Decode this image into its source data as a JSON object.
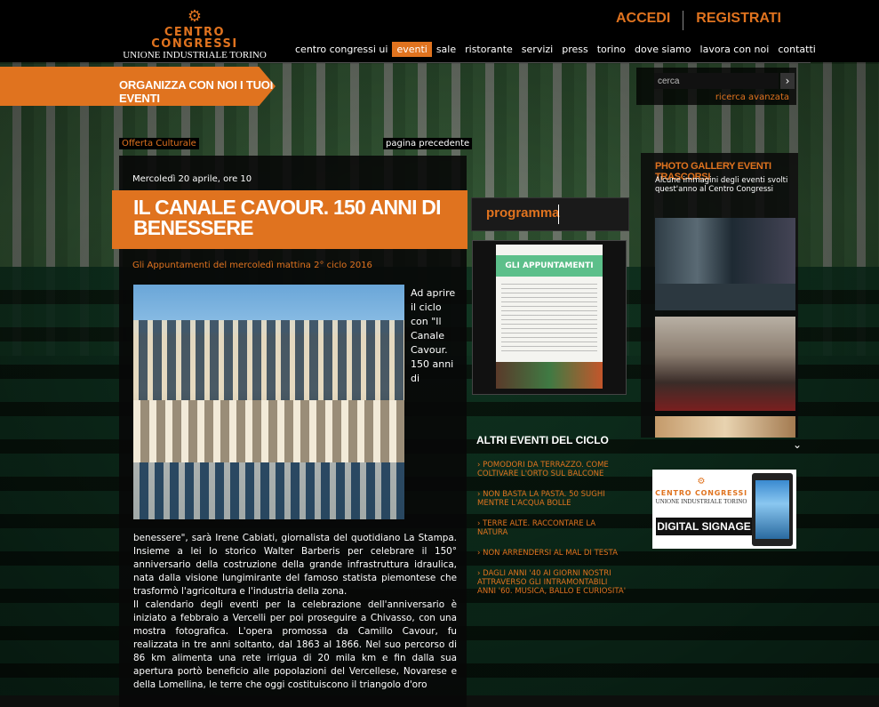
{
  "header": {
    "logo_mark": "⚙",
    "logo_line1": "CENTRO CONGRESSI",
    "logo_line2": "UNIONE INDUSTRIALE TORINO",
    "login": "ACCEDI",
    "register": "REGISTRATI"
  },
  "nav": {
    "items": [
      "centro congressi ui",
      "eventi",
      "sale",
      "ristorante",
      "servizi",
      "press",
      "torino",
      "dove siamo",
      "lavora con noi",
      "contatti"
    ],
    "active": "eventi"
  },
  "banner": {
    "label": "ORGANIZZA CON NOI I TUOI EVENTI"
  },
  "search": {
    "value": "cerca",
    "go_symbol": "›",
    "advanced": "ricerca avanzata"
  },
  "article": {
    "category": "Offerta Culturale",
    "back": "pagina precedente",
    "date": "Mercoledì 20 aprile, ore 10",
    "title": "IL CANALE CAVOUR. 150 ANNI DI BENESSERE",
    "subtitle": "Gli Appuntamenti del mercoledì mattina 2° ciclo 2016",
    "side_text": "Ad aprire il ciclo con \"Il Canale Cavour. 150 anni di",
    "paragraph1": "benessere\", sarà Irene Cabiati, giornalista del quotidiano La Stampa. Insieme a lei lo storico Walter Barberis per celebrare il 150° anniversario della costruzione della grande infrastruttura idraulica, nata dalla visione lungimirante del famoso statista piemontese che trasformò l'agricoltura e l'industria della zona.",
    "paragraph2": "Il calendario degli eventi per la celebrazione dell'anniversario è iniziato a febbraio a Vercelli per poi proseguire a Chivasso, con una mostra fotografica. L'opera promossa da Camillo Cavour, fu realizzata in tre anni soltanto, dal 1863 al 1866. Nel suo percorso di 86 km alimenta una rete irrigua di 20 mila km e fin dalla sua apertura portò beneficio alle popolazioni del Vercellese, Novarese e della Lomellina, le terre che oggi costituiscono il triangolo d'oro"
  },
  "programma": {
    "label": "programma",
    "poster_title": "GLI APPUNTAMENTI"
  },
  "altri_eventi": {
    "title": "ALTRI EVENTI DEL CICLO",
    "items": [
      "› POMODORI DA TERRAZZO. COME COLTIVARE L'ORTO SUL BALCONE",
      "› NON BASTA LA PASTA. 50 SUGHI MENTRE L'ACQUA BOLLE",
      "› TERRE ALTE. RACCONTARE LA NATURA",
      "› NON ARRENDERSI AL MAL DI TESTA",
      "› DAGLI ANNI '40 AI GIORNI NOSTRI ATTRAVERSO GLI INTRAMONTABILI ANNI '60. MUSICA, BALLO E CURIOSITA'"
    ]
  },
  "gallery": {
    "title": "PHOTO GALLERY EVENTI TRASCORSI",
    "description": "Alcune immagini degli eventi svolti quest'anno al Centro Congressi",
    "more_symbol": "⌄"
  },
  "ad": {
    "mark": "⚙",
    "line1": "CENTRO CONGRESSI",
    "line2": "UNIONE INDUSTRIALE TORINO",
    "label": "DIGITAL SIGNAGE"
  },
  "colors": {
    "accent": "#e0731f",
    "panel": "#080808"
  }
}
